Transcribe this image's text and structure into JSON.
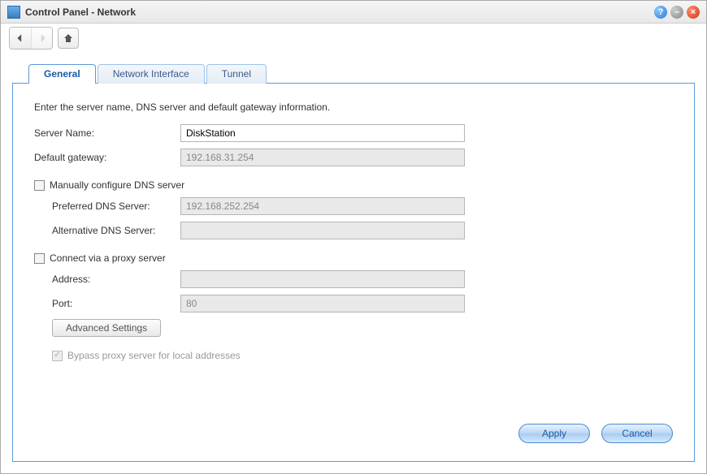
{
  "window": {
    "title": "Control Panel - Network"
  },
  "tabs": {
    "general": "General",
    "network_interface": "Network Interface",
    "tunnel": "Tunnel"
  },
  "general": {
    "instruction": "Enter the server name, DNS server and default gateway information.",
    "server_name_label": "Server Name:",
    "server_name_value": "DiskStation",
    "default_gateway_label": "Default gateway:",
    "default_gateway_value": "192.168.31.254",
    "manual_dns_label": "Manually configure DNS server",
    "preferred_dns_label": "Preferred DNS Server:",
    "preferred_dns_value": "192.168.252.254",
    "alternative_dns_label": "Alternative DNS Server:",
    "alternative_dns_value": "",
    "proxy_label": "Connect via a proxy server",
    "proxy_address_label": "Address:",
    "proxy_address_value": "",
    "proxy_port_label": "Port:",
    "proxy_port_value": "80",
    "advanced_settings": "Advanced Settings",
    "bypass_label": "Bypass proxy server for local addresses"
  },
  "footer": {
    "apply": "Apply",
    "cancel": "Cancel"
  }
}
